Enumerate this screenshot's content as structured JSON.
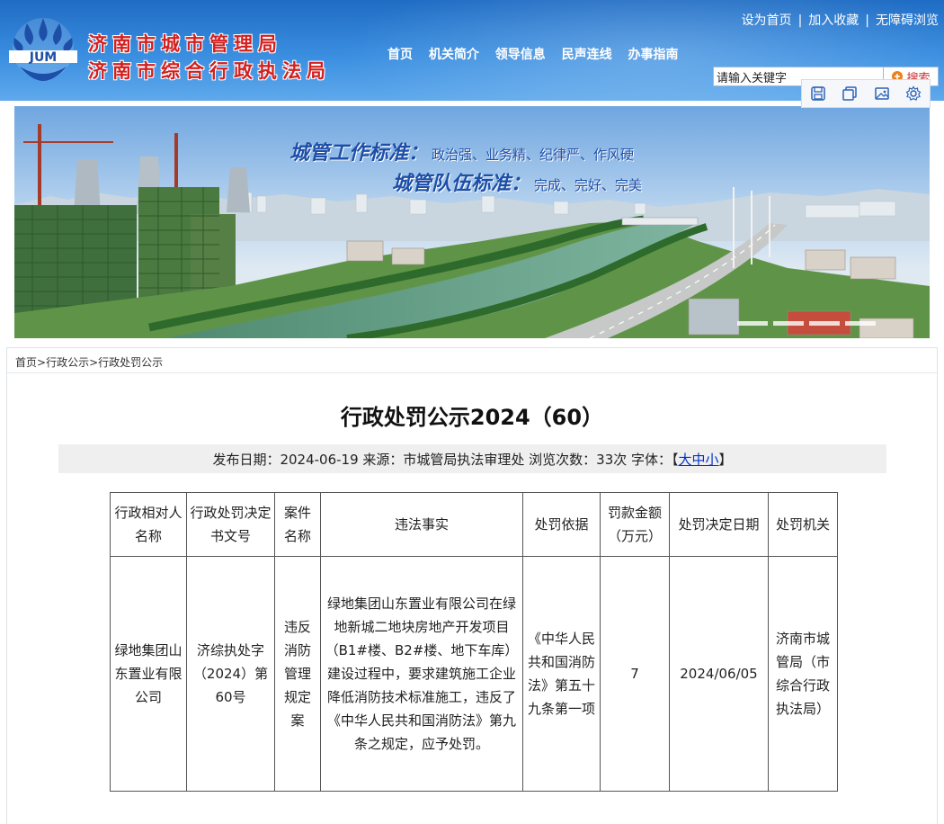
{
  "header": {
    "org_name_line1": "济南市城市管理局",
    "org_name_line2": "济南市综合行政执法局",
    "logo_text": "JUM",
    "top_links": [
      "设为首页",
      "加入收藏",
      "无障碍浏览"
    ],
    "top_sep": "|",
    "nav": [
      "首页",
      "机关简介",
      "领导信息",
      "民声连线",
      "办事指南"
    ],
    "search_placeholder": "请输入关键字",
    "search_button": "搜索"
  },
  "banner": {
    "slogan1_title": "城管工作标准：",
    "slogan1_text": "政治强、业务精、纪律严、作风硬",
    "slogan2_title": "城管队伍标准：",
    "slogan2_text": "完成、完好、完美"
  },
  "breadcrumb": [
    "首页",
    "行政公示",
    "行政处罚公示"
  ],
  "breadcrumb_sep": ">",
  "article": {
    "title": "行政处罚公示2024（60）",
    "meta_prefix": "发布日期：2024-06-19 来源：市城管局执法审理处 浏览次数：33次 字体：【",
    "font_sizes": "大中小",
    "meta_suffix": "】"
  },
  "table": {
    "headers": [
      "行政相对人名称",
      "行政处罚决定书文号",
      "案件名称",
      "违法事实",
      "处罚依据",
      "罚款金额（万元）",
      "处罚决定日期",
      "处罚机关"
    ],
    "row": [
      "绿地集团山东置业有限公司",
      "济综执处字（2024）第60号",
      "违反消防管理规定案",
      "绿地集团山东置业有限公司在绿地新城二地块房地产开发项目（B1#楼、B2#楼、地下车库）建设过程中，要求建筑施工企业降低消防技术标准施工，违反了《中华人民共和国消防法》第九条之规定，应予处罚。",
      "《中华人民共和国消防法》第五十九条第一项",
      "7",
      "2024/06/05",
      "济南市城管局（市综合行政执法局）"
    ]
  },
  "colors": {
    "header_blue": "#2a7fd6",
    "org_red": "#d21f1f",
    "link_blue": "#0033cc"
  },
  "icons": [
    "save-icon",
    "copy-icon",
    "image-icon",
    "settings-icon",
    "search-icon"
  ]
}
